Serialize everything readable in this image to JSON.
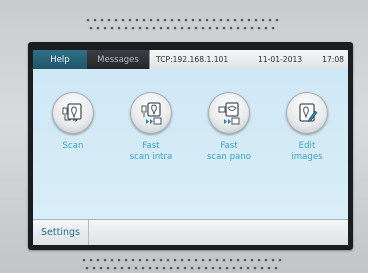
{
  "topbar": {
    "help_label": "Help",
    "messages_label": "Messages",
    "connection": "TCP:192.168.1.101",
    "date": "11-01-2013",
    "time": "17:08"
  },
  "actions": [
    {
      "label_line1": "Scan",
      "label_line2": "",
      "icon": "scan-icon"
    },
    {
      "label_line1": "Fast",
      "label_line2": "scan intra",
      "icon": "fast-scan-intra-icon"
    },
    {
      "label_line1": "Fast",
      "label_line2": "scan pano",
      "icon": "fast-scan-pano-icon"
    },
    {
      "label_line1": "Edit",
      "label_line2": "images",
      "icon": "edit-images-icon"
    }
  ],
  "bottombar": {
    "settings_label": "Settings"
  },
  "colors": {
    "accent": "#3aa3c9",
    "help_tab": "#1f5669",
    "screen_bg": "#d6ecf7",
    "bezel": "#1b1d20"
  }
}
